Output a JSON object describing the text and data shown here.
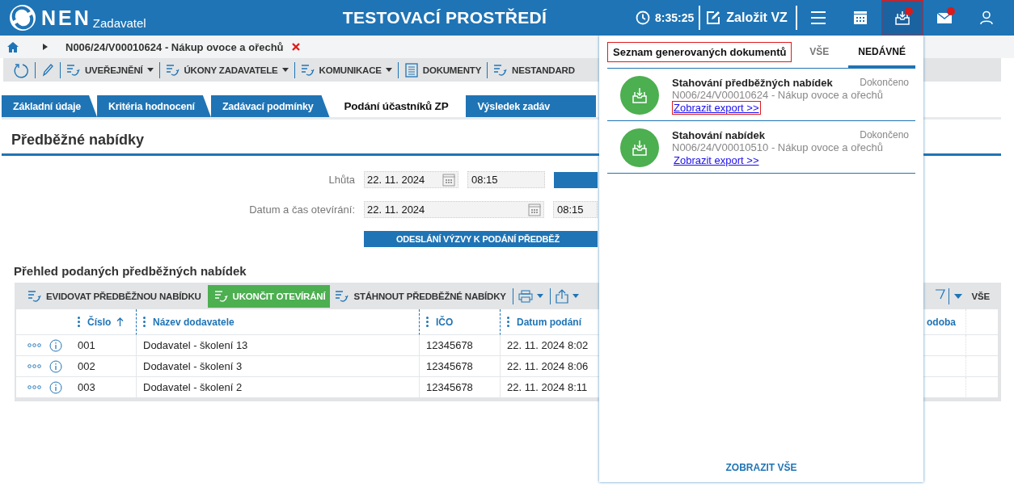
{
  "header": {
    "logo": "NEN",
    "logo_sub": "Zadavatel",
    "environment": "TESTOVACÍ PROSTŘEDÍ",
    "time": "8:35:25",
    "create_button": "Založit VZ",
    "icons": [
      {
        "kind": "menu",
        "selected": false,
        "badge": false,
        "highlighted": false
      },
      {
        "kind": "calendar",
        "selected": false,
        "badge": false,
        "highlighted": false
      },
      {
        "kind": "inbox",
        "selected": true,
        "badge": true,
        "highlighted": true
      },
      {
        "kind": "mail",
        "selected": false,
        "badge": true,
        "highlighted": false
      },
      {
        "kind": "user",
        "selected": false,
        "badge": false,
        "highlighted": false
      }
    ]
  },
  "breadcrumb": {
    "title": "N006/24/V00010624 - Nákup ovoce a ořechů"
  },
  "toolbar": [
    {
      "kind": "refresh"
    },
    {
      "kind": "edit"
    },
    {
      "kind": "action",
      "label": "UVEŘEJNĚNÍ",
      "dropdown": true
    },
    {
      "kind": "action",
      "label": "ÚKONY ZADAVATELE",
      "dropdown": true
    },
    {
      "kind": "action",
      "label": "KOMUNIKACE",
      "dropdown": true
    },
    {
      "kind": "document",
      "label": "DOKUMENTY",
      "dropdown": false
    },
    {
      "kind": "action",
      "label": "NESTANDARD",
      "dropdown": false
    }
  ],
  "tabs": [
    {
      "label": "Základní údaje",
      "selected": false
    },
    {
      "label": "Kritéria hodnocení",
      "selected": false
    },
    {
      "label": "Zadávací podmínky",
      "selected": false
    },
    {
      "label": "Podání účastníků ZP",
      "selected": true
    },
    {
      "label": "Výsledek zadáv",
      "selected": false
    }
  ],
  "section": {
    "title": "Předběžné nabídky",
    "fields": [
      {
        "label": "Lhůta",
        "date": "22. 11. 2024",
        "time": "08:15",
        "wide": false
      },
      {
        "label": "Datum a čas otevírání:",
        "date": "22. 11. 2024",
        "time": "08:15",
        "wide": true
      }
    ],
    "send_button": "ODESLÁNÍ VÝZVY K PODÁNÍ PŘEDBĚŽ"
  },
  "offers": {
    "title": "Přehled podaných předběžných nabídek",
    "toolbar": [
      {
        "label": "EVIDOVAT PŘEDBĚŽNOU NABÍDKU",
        "primary": false
      },
      {
        "label": "UKONČIT OTEVÍRÁNÍ",
        "primary": true
      },
      {
        "label": "STÁHNOUT PŘEDBĚŽNÉ NABÍDKY",
        "primary": false
      }
    ],
    "filter_button": "VŠE",
    "columns": [
      {
        "label": "Číslo",
        "sorted": true
      },
      {
        "label": "Název dodavatele",
        "sorted": false
      },
      {
        "label": "IČO",
        "sorted": false
      },
      {
        "label": "Datum podání",
        "sorted": false
      },
      {
        "label": "odoba",
        "sorted": false
      }
    ],
    "rows": [
      {
        "number": "001",
        "supplier": "Dodavatel - školení 13",
        "ico": "12345678",
        "date": "22. 11. 2024 8:02"
      },
      {
        "number": "002",
        "supplier": "Dodavatel - školení 3",
        "ico": "12345678",
        "date": "22. 11. 2024 8:06"
      },
      {
        "number": "003",
        "supplier": "Dodavatel - školení 2",
        "ico": "12345678",
        "date": "22. 11. 2024 8:11"
      }
    ]
  },
  "documents_panel": {
    "title": "Seznam generovaných dokumentů",
    "title_highlighted": true,
    "tabs": [
      {
        "label": "VŠE",
        "selected": false
      },
      {
        "label": "NEDÁVNÉ",
        "selected": true
      }
    ],
    "items": [
      {
        "title": "Stahování předběžných nabídek",
        "status": "Dokončeno",
        "reference": "N006/24/V00010624 - Nákup ovoce a ořechů",
        "link": "Zobrazit export >>",
        "link_highlighted": true
      },
      {
        "title": "Stahování nabídek",
        "status": "Dokončeno",
        "reference": "N006/24/V00010510 - Nákup ovoce a ořechů",
        "link": "Zobrazit export >>",
        "link_highlighted": false
      }
    ],
    "show_all": "ZOBRAZIT VŠE"
  }
}
